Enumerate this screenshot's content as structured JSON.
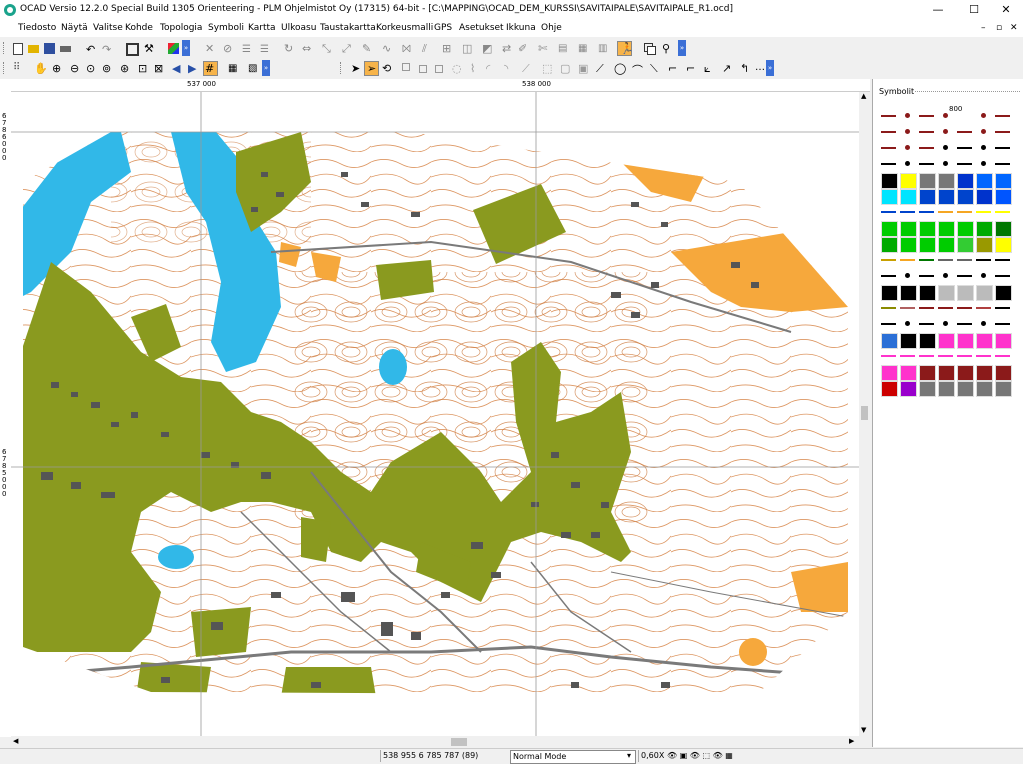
{
  "window": {
    "title": "OCAD Versio 12.2.0  Special Build 1305  Orienteering - PLM Ohjelmistot Oy (17315) 64-bit - [C:\\MAPPING\\OCAD_DEM_KURSSI\\SAVITAIPALE\\SAVITAIPALE_R1.ocd]",
    "minimize": "—",
    "maximize": "☐",
    "close": "✕"
  },
  "menu": [
    "Tiedosto",
    "Näytä",
    "Valitse",
    "Kohde",
    "Topologia",
    "Symboli",
    "Kartta",
    "Ulkoasu",
    "Taustakartta",
    "Korkeusmalli",
    "GPS",
    "Asetukset",
    "Ikkuna",
    "Ohje"
  ],
  "mdi_controls": {
    "minimize": "–",
    "restore": "▫",
    "close": "✕"
  },
  "rulers": {
    "x_labels": [
      "537 000",
      "538 000"
    ],
    "y_labels": [
      "6 786 000",
      "6 785 000"
    ]
  },
  "symbols_panel": {
    "title": "Symbolit",
    "header_text": "800"
  },
  "status": {
    "coordinates": "538 955   6 785 787  (89)",
    "mode": "Normal Mode",
    "zoom": "0,60X"
  },
  "colors": {
    "forest_green": "#8a9a1f",
    "contour_brown": "#c87637",
    "water_blue": "#31b8e8",
    "open_land_orange": "#f6a83c",
    "building_gray": "#555555"
  },
  "icons": {
    "toolbar1": [
      "new-icon",
      "open-icon",
      "save-icon",
      "print-icon",
      "undo-icon",
      "redo-icon",
      "fullscreen-icon",
      "hammer-icon",
      "color-icon"
    ],
    "toolbar2": [
      "grip-icon",
      "pan-icon",
      "zoom-in-icon",
      "zoom-out-icon",
      "select-icon",
      "draw-icon"
    ]
  }
}
